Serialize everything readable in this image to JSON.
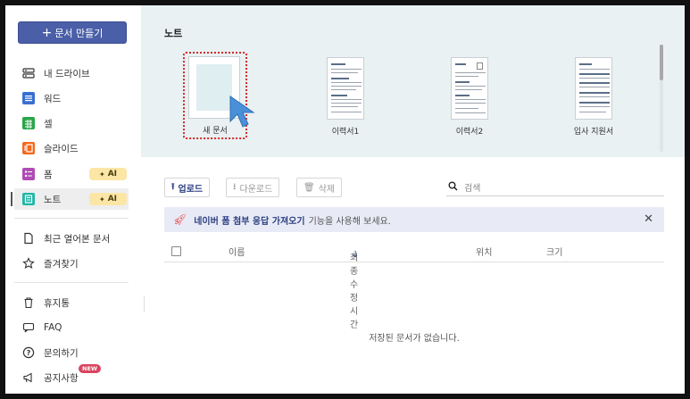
{
  "sidebar": {
    "create_label": "문서 만들기",
    "items": [
      {
        "label": "내 드라이브"
      },
      {
        "label": "워드"
      },
      {
        "label": "셀"
      },
      {
        "label": "슬라이드"
      },
      {
        "label": "폼",
        "badge": "AI"
      },
      {
        "label": "노트",
        "badge": "AI"
      },
      {
        "label": "최근 열어본 문서"
      },
      {
        "label": "즐겨찾기"
      },
      {
        "label": "휴지통"
      },
      {
        "label": "FAQ"
      },
      {
        "label": "문의하기"
      },
      {
        "label": "공지사항",
        "badge": "NEW"
      }
    ]
  },
  "templates": {
    "title": "노트",
    "cards": [
      {
        "label": "새 문서"
      },
      {
        "label": "이력서1"
      },
      {
        "label": "이력서2"
      },
      {
        "label": "입사 지원서"
      }
    ]
  },
  "toolbar": {
    "upload": "업로드",
    "download": "다운로드",
    "delete": "삭제",
    "search_placeholder": "검색"
  },
  "notice": {
    "highlight": "네이버 폼 첨부 응답 가져오기",
    "text": "기능을 사용해 보세요."
  },
  "table": {
    "columns": [
      "이름",
      "최종 수정 시간",
      "위치",
      "크기"
    ],
    "empty_message": "저장된 문서가 없습니다."
  },
  "colors": {
    "brand": "#4a5fa8",
    "template_bg": "#e9f1f3",
    "ai_badge": "#fbe6a6",
    "new_badge": "#d9455f"
  }
}
